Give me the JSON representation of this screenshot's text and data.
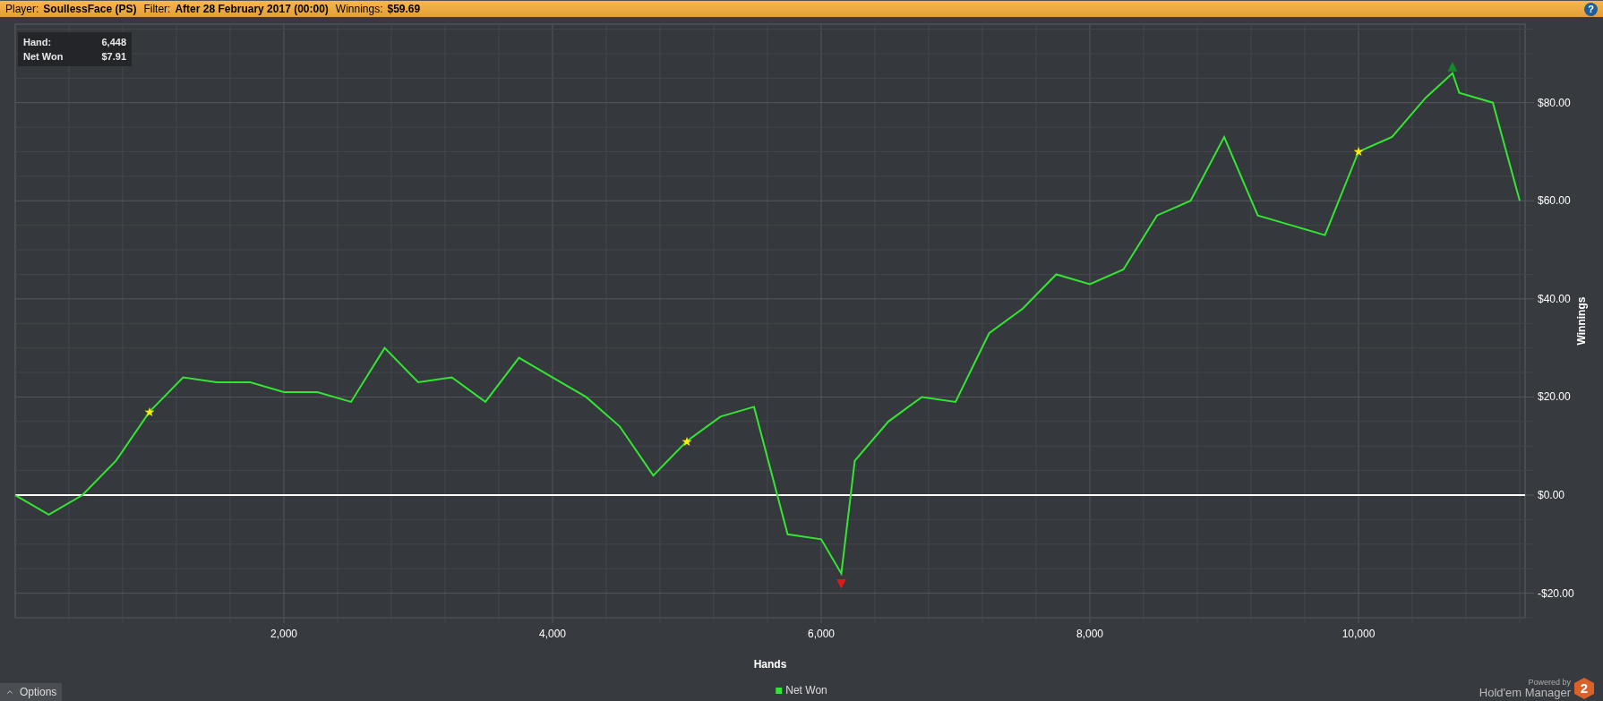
{
  "header": {
    "items": [
      {
        "label": "Player:",
        "value": "SoullessFace (PS)"
      },
      {
        "label": "Filter:",
        "value": "After 28 February 2017 (00:00)"
      },
      {
        "label": "Winnings:",
        "value": "$59.69"
      }
    ],
    "help": "?"
  },
  "tooltip": {
    "rows": [
      {
        "label": "Hand:",
        "value": "6,448"
      },
      {
        "label": "Net Won",
        "value": "$7.91"
      }
    ]
  },
  "chart_data": {
    "type": "line",
    "xlabel": "Hands",
    "ylabel": "Winnings",
    "xlim": [
      0,
      11240
    ],
    "ylim": [
      -25,
      96
    ],
    "xticks": [
      {
        "value": 2000,
        "label": "2,000"
      },
      {
        "value": 4000,
        "label": "4,000"
      },
      {
        "value": 6000,
        "label": "6,000"
      },
      {
        "value": 8000,
        "label": "8,000"
      },
      {
        "value": 10000,
        "label": "10,000"
      }
    ],
    "yticks": [
      {
        "value": -20,
        "label": "-$20.00"
      },
      {
        "value": 0,
        "label": "$0.00"
      },
      {
        "value": 20,
        "label": "$20.00"
      },
      {
        "value": 40,
        "label": "$40.00"
      },
      {
        "value": 60,
        "label": "$60.00"
      },
      {
        "value": 80,
        "label": "$80.00"
      }
    ],
    "x": [
      0,
      250,
      500,
      750,
      1000,
      1250,
      1500,
      1750,
      2000,
      2250,
      2500,
      2750,
      3000,
      3250,
      3500,
      3750,
      4000,
      4250,
      4500,
      4750,
      5000,
      5250,
      5500,
      5750,
      6000,
      6150,
      6250,
      6500,
      6750,
      7000,
      7250,
      7500,
      7750,
      8000,
      8250,
      8500,
      8750,
      9000,
      9250,
      9500,
      9750,
      10000,
      10250,
      10500,
      10700,
      10750,
      11000,
      11200
    ],
    "series": [
      {
        "name": "Net Won",
        "color": "#33e633",
        "values": [
          0,
          -4,
          0,
          7,
          17,
          24,
          23,
          23,
          21,
          21,
          19,
          30,
          23,
          24,
          19,
          28,
          24,
          20,
          14,
          4,
          11,
          16,
          18,
          -8,
          -9,
          -16,
          7,
          15,
          20,
          19,
          33,
          38,
          45,
          43,
          46,
          57,
          60,
          73,
          57,
          55,
          53,
          70,
          73,
          81,
          86,
          82,
          80,
          60
        ]
      }
    ],
    "grid": true,
    "annotations": [
      {
        "text": "★",
        "x": 1000,
        "y": 17
      },
      {
        "text": "★",
        "x": 5000,
        "y": 11
      },
      {
        "text": "★",
        "x": 10000,
        "y": 70
      },
      {
        "text": "▼",
        "x": 6150,
        "y": -16
      },
      {
        "text": "▲",
        "x": 10700,
        "y": 86
      }
    ]
  },
  "options_button": {
    "label": "Options"
  },
  "branding": {
    "powered_by": "Powered by",
    "name": "Hold'em Manager",
    "badge": "2"
  }
}
